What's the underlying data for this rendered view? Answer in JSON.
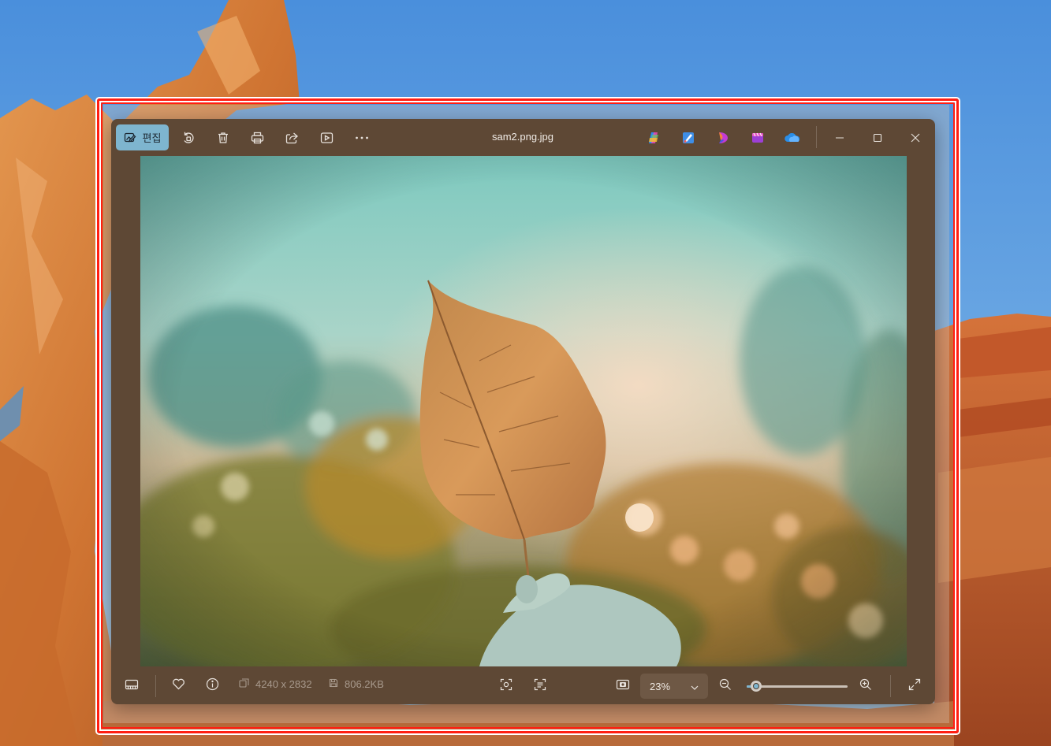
{
  "window": {
    "title": "sam2.png.jpg",
    "edit_label": "편집"
  },
  "toolbar_icons": [
    "edit-image-icon",
    "rotate-icon",
    "delete-icon",
    "print-icon",
    "share-icon",
    "slideshow-icon",
    "more-icon"
  ],
  "app_icons": [
    "copilot-icon",
    "paint-icon",
    "designer-icon",
    "clipchamp-icon",
    "onedrive-icon"
  ],
  "window_controls": [
    "minimize-icon",
    "maximize-icon",
    "close-icon"
  ],
  "statusbar": {
    "dimensions": "4240 x 2832",
    "file_size": "806.2KB",
    "zoom": "23%",
    "zoom_level": 0.09
  },
  "colors": {
    "highlight": "#ff1e12",
    "accent": "#7eb5cf",
    "window_bg": "#5e4835"
  }
}
